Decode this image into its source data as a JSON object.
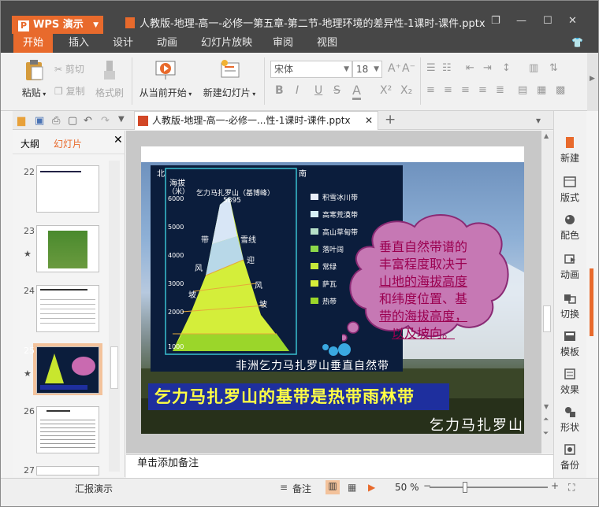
{
  "app": {
    "name": "WPS 演示",
    "doc_title": "人教版-地理-高一-必修一第五章-第二节-地理环境的差异性-1课时-课件.pptx"
  },
  "menu": {
    "tabs": [
      "开始",
      "插入",
      "设计",
      "动画",
      "幻灯片放映",
      "审阅",
      "视图"
    ],
    "active": "开始"
  },
  "ribbon": {
    "paste": "粘贴",
    "cut": "剪切",
    "copy": "复制",
    "format_painter": "格式刷",
    "from_current": "从当前开始",
    "new_slide": "新建幻灯片",
    "font_name": "宋体",
    "font_size": "18",
    "bold": "B",
    "italic": "I",
    "underline": "U",
    "strike": "S",
    "font_color": "A",
    "superscript": "X²",
    "subscript": "X₂"
  },
  "doc_tab": {
    "label": "人教版-地理-高一-必修一...性-1课时-课件.pptx"
  },
  "left_panel": {
    "tab_outline": "大纲",
    "tab_slides": "幻灯片",
    "slides": [
      {
        "num": "22"
      },
      {
        "num": "23"
      },
      {
        "num": "24"
      },
      {
        "num": "25"
      },
      {
        "num": "26"
      },
      {
        "num": "27"
      }
    ]
  },
  "slide": {
    "diagram_north": "北",
    "diagram_south": "南",
    "diagram_axis_title": "海拔",
    "diagram_axis_unit": "（米）",
    "diagram_mountain": "乞力马扎罗山（基博峰）",
    "diagram_peak": "5895",
    "diagram_ticks": [
      "6000",
      "5000",
      "4000",
      "3000",
      "2000",
      "1000"
    ],
    "diagram_legend": [
      "积雪冰川带",
      "高寒荒漠带",
      "高山草甸带",
      "落叶阔",
      "常绿",
      "萨瓦",
      "热带"
    ],
    "diagram_labels": [
      "带",
      "雪线",
      "迎",
      "风",
      "坡",
      "风",
      "坡"
    ],
    "cloud_lines": [
      {
        "text": "垂直自然带谱的",
        "underline": false
      },
      {
        "text": "丰富程度取决于",
        "underline": false
      },
      {
        "text": "山地的海拔高度",
        "underline": true
      },
      {
        "text": "和纬度位置、基",
        "underline": false
      },
      {
        "text": "带的海拔高度，",
        "underline": true
      },
      {
        "text": "以及坡向。",
        "underline": true
      }
    ],
    "caption_small": "非洲乞力马扎罗山垂直自然带",
    "caption_main": "乞力马扎罗山的基带是热带雨林带",
    "caption_corner": "乞力马扎罗山"
  },
  "notes_placeholder": "单击添加备注",
  "right_sidebar": [
    "新建",
    "版式",
    "配色",
    "动画",
    "切换",
    "模板",
    "效果",
    "形状",
    "备份"
  ],
  "status": {
    "mode": "汇报演示",
    "notes": "备注",
    "zoom": "50 %"
  },
  "colors": {
    "accent": "#e86a2c",
    "titlebar": "#474747",
    "cloud_text": "#9b0050",
    "caption_bg": "#1e2f9e",
    "caption_text": "#ffff44"
  }
}
